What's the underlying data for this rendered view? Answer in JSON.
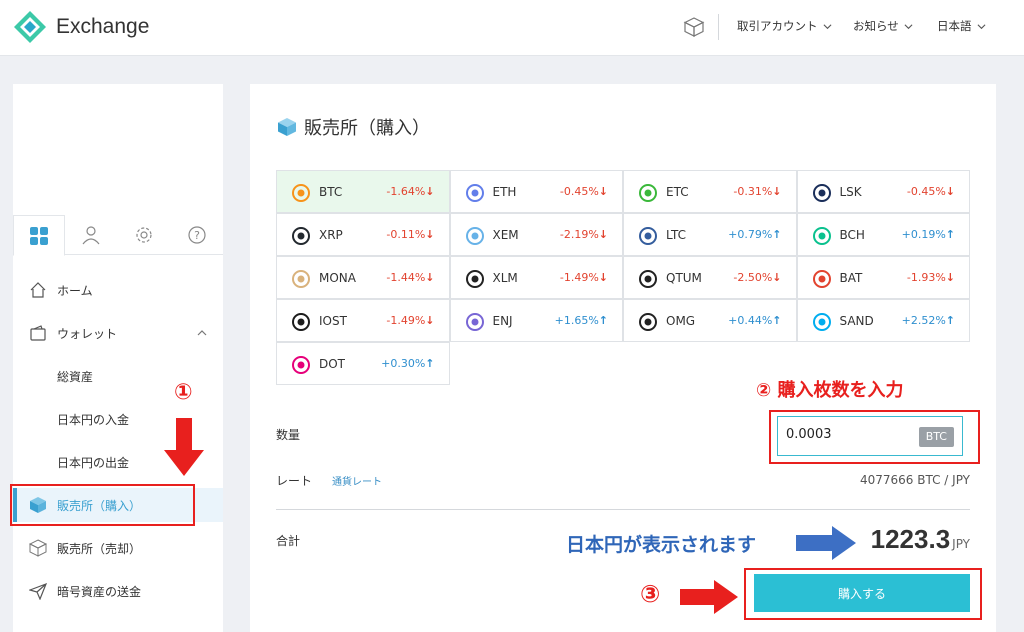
{
  "header": {
    "app_name": "Exchange",
    "menus": [
      {
        "label": "取引アカウント"
      },
      {
        "label": "お知らせ"
      },
      {
        "label": "日本語"
      }
    ]
  },
  "sidebar": {
    "items": [
      {
        "label": "ホーム"
      },
      {
        "label": "ウォレット"
      },
      {
        "label": "総資産"
      },
      {
        "label": "日本円の入金"
      },
      {
        "label": "日本円の出金"
      },
      {
        "label": "販売所（購入）"
      },
      {
        "label": "販売所（売却）"
      },
      {
        "label": "暗号資産の送金"
      }
    ]
  },
  "main": {
    "title": "販売所（購入）",
    "coins": [
      {
        "symbol": "BTC",
        "change": "-1.64%",
        "dir": "down",
        "color": "#f7931a"
      },
      {
        "symbol": "ETH",
        "change": "-0.45%",
        "dir": "down",
        "color": "#627eea"
      },
      {
        "symbol": "ETC",
        "change": "-0.31%",
        "dir": "down",
        "color": "#3ab83a"
      },
      {
        "symbol": "LSK",
        "change": "-0.45%",
        "dir": "down",
        "color": "#1a2e5a"
      },
      {
        "symbol": "XRP",
        "change": "-0.11%",
        "dir": "down",
        "color": "#23292f"
      },
      {
        "symbol": "XEM",
        "change": "-2.19%",
        "dir": "down",
        "color": "#67b2e8"
      },
      {
        "symbol": "LTC",
        "change": "+0.79%",
        "dir": "up",
        "color": "#345d9d"
      },
      {
        "symbol": "BCH",
        "change": "+0.19%",
        "dir": "up",
        "color": "#0ac18e"
      },
      {
        "symbol": "MONA",
        "change": "-1.44%",
        "dir": "down",
        "color": "#d9b27c"
      },
      {
        "symbol": "XLM",
        "change": "-1.49%",
        "dir": "down",
        "color": "#222222"
      },
      {
        "symbol": "QTUM",
        "change": "-2.50%",
        "dir": "down",
        "color": "#222222"
      },
      {
        "symbol": "BAT",
        "change": "-1.93%",
        "dir": "down",
        "color": "#e2432f"
      },
      {
        "symbol": "IOST",
        "change": "-1.49%",
        "dir": "down",
        "color": "#1c1c1c"
      },
      {
        "symbol": "ENJ",
        "change": "+1.65%",
        "dir": "up",
        "color": "#7866d5"
      },
      {
        "symbol": "OMG",
        "change": "+0.44%",
        "dir": "up",
        "color": "#222222"
      },
      {
        "symbol": "SAND",
        "change": "+2.52%",
        "dir": "up",
        "color": "#00adef"
      },
      {
        "symbol": "DOT",
        "change": "+0.30%",
        "dir": "up",
        "color": "#e6007a"
      }
    ],
    "quantity_label": "数量",
    "quantity_value": "0.0003",
    "quantity_unit": "BTC",
    "rate_label": "レート",
    "rate_link": "通貨レート",
    "rate_value": "4077666  BTC / JPY",
    "total_label": "合計",
    "total_value": "1223.3",
    "total_unit": "JPY",
    "buy_button": "購入する"
  },
  "annotations": {
    "step1": "①",
    "step2": "②  購入枚数を入力",
    "step3": "③",
    "note": "日本円が表示されます"
  },
  "colors": {
    "accent": "#2bbfd4",
    "annotation_red": "#e8201e",
    "annotation_blue": "#2f66b8",
    "negative": "#e2432f",
    "positive": "#2f8fcf"
  }
}
